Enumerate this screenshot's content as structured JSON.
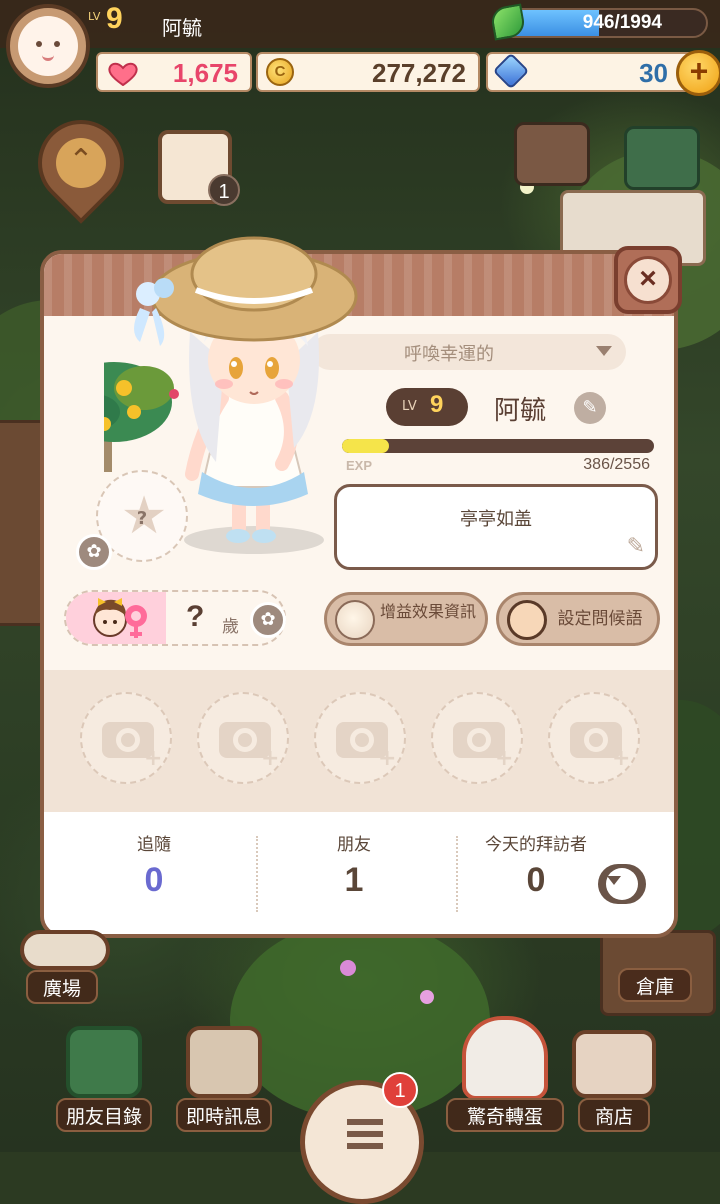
{
  "topbar": {
    "level_label": "LV",
    "level": "9",
    "player_name": "阿毓",
    "energy_text": "946/1994",
    "energy_fraction": 0.474
  },
  "resources": {
    "hearts": "1,675",
    "coins": "277,272",
    "coin_symbol": "C",
    "gems": "30",
    "add_label": "+"
  },
  "background": {
    "calendar_badge": "1"
  },
  "profile": {
    "close_label": "×",
    "title_dropdown": "呼喚幸運的",
    "level_label": "LV",
    "level": "9",
    "name": "阿毓",
    "exp_label": "EXP",
    "exp_value": "386/2556",
    "exp_fraction": 0.151,
    "status_message": "亭亭如盖",
    "age_value": "?",
    "age_unit": "歲",
    "mystery_mark": "?",
    "buttons": {
      "buff_info": "增益效果資訊",
      "greeting": "設定問候語"
    },
    "photo_slots": 5,
    "stats": {
      "follow_label": "追隨",
      "follow_value": "0",
      "friends_label": "朋友",
      "friends_value": "1",
      "visitors_label": "今天的拜訪者",
      "visitors_value": "0"
    }
  },
  "nav": {
    "plaza": "廣場",
    "warehouse": "倉庫",
    "friends_list": "朋友目錄",
    "messages": "即時訊息",
    "gacha": "驚奇轉蛋",
    "shop": "商店",
    "menu_badge": "1"
  },
  "colors": {
    "panel_border": "#8a5e44",
    "header": "#b77d66",
    "energy": "#3b8fe3",
    "exp_fill": "#f5e44a",
    "follow_value": "#6a6ad0"
  }
}
